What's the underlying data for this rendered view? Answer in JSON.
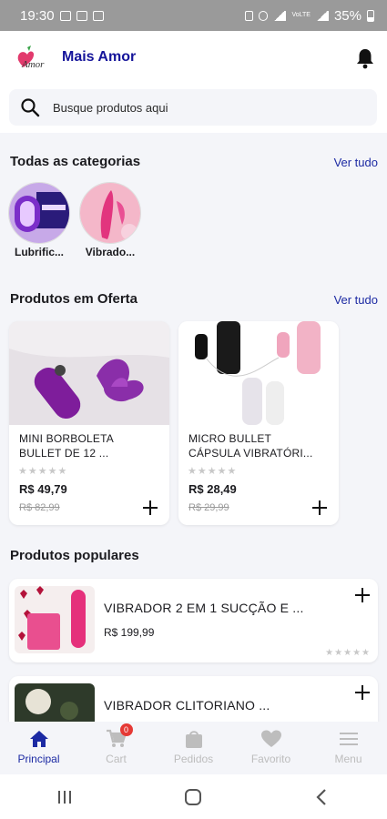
{
  "status_bar": {
    "time": "19:30",
    "network": "VoLTE",
    "battery": "35%"
  },
  "header": {
    "brand": "Mais Amor",
    "logo_text": "Amor"
  },
  "search": {
    "placeholder": "Busque produtos aqui"
  },
  "categories": {
    "title": "Todas as categorias",
    "see_all": "Ver tudo",
    "items": [
      {
        "label": "Lubrific..."
      },
      {
        "label": "Vibrado..."
      }
    ]
  },
  "offers": {
    "title": "Produtos em Oferta",
    "see_all": "Ver tudo",
    "items": [
      {
        "name": "MINI BORBOLETA BULLET DE 12 ...",
        "price": "R$ 49,79",
        "old_price": "R$ 82,99",
        "rating": "★★★★★"
      },
      {
        "name": "MICRO BULLET CÁPSULA VIBRATÓRI...",
        "price": "R$ 28,49",
        "old_price": "R$ 29,99",
        "rating": "★★★★★"
      }
    ]
  },
  "popular": {
    "title": "Produtos populares",
    "items": [
      {
        "name": "VIBRADOR 2 EM 1 SUCÇÃO E ...",
        "price": "R$ 199,99",
        "rating": "★★★★★"
      },
      {
        "name": "VIBRADOR CLITORIANO ...",
        "price": "",
        "rating": ""
      }
    ]
  },
  "bottom_nav": {
    "items": [
      {
        "label": "Principal",
        "icon": "home-icon",
        "active": true
      },
      {
        "label": "Cart",
        "icon": "cart-icon",
        "badge": "0"
      },
      {
        "label": "Pedidos",
        "icon": "bag-icon"
      },
      {
        "label": "Favorito",
        "icon": "heart-icon"
      },
      {
        "label": "Menu",
        "icon": "menu-icon"
      }
    ]
  },
  "colors": {
    "accent": "#1c2aa3",
    "brand": "#15149a",
    "badge": "#e53935"
  }
}
